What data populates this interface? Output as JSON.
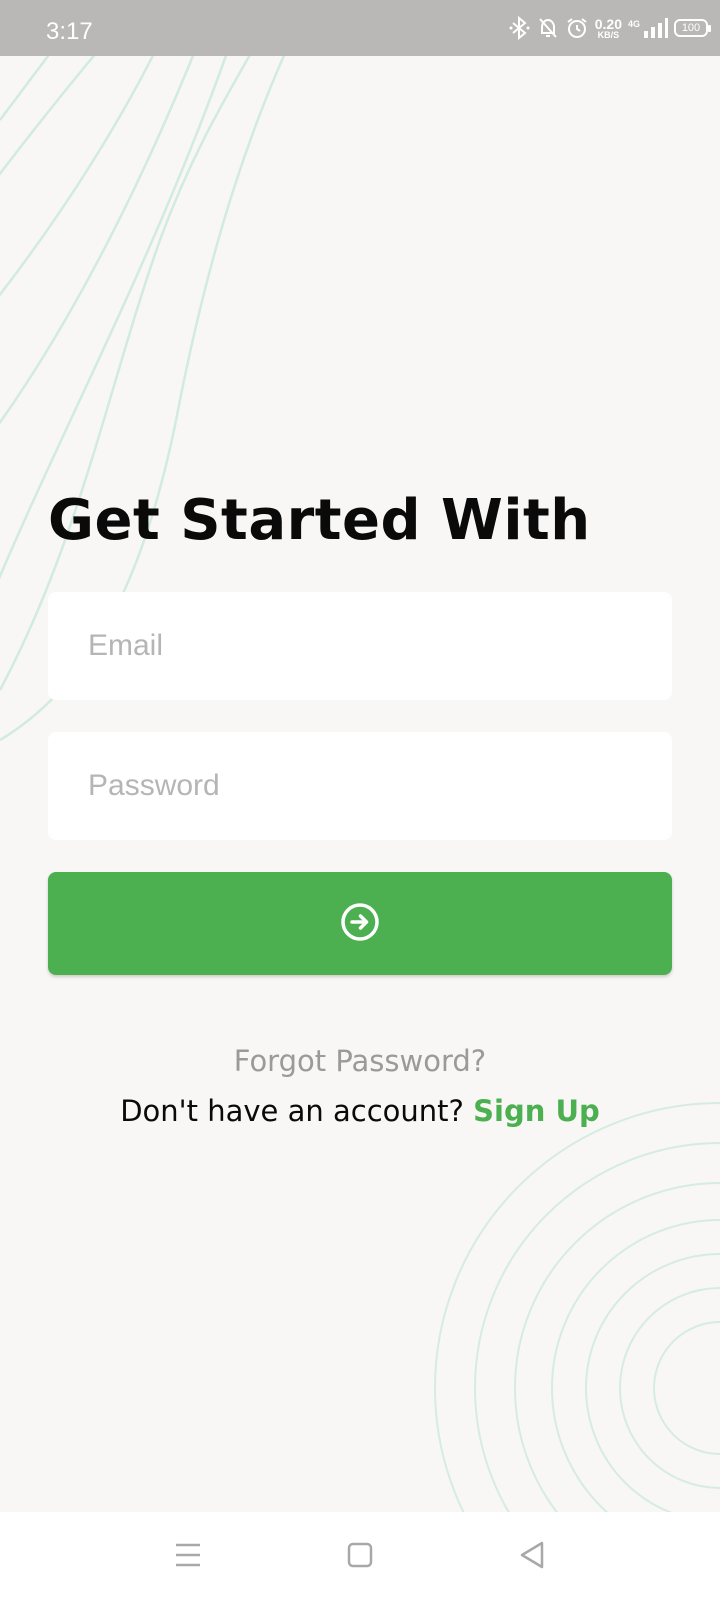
{
  "status_bar": {
    "time": "3:17",
    "net_speed_value": "0.20",
    "net_speed_unit": "KB/S",
    "network_type": "4G",
    "battery": "100",
    "icons": [
      "bluetooth-icon",
      "mute-notification-icon",
      "alarm-icon",
      "signal-icon",
      "battery-icon"
    ]
  },
  "login": {
    "title": "Get Started With",
    "email_placeholder": "Email",
    "password_placeholder": "Password",
    "submit_icon": "arrow-right-circle-icon",
    "forgot_password": "Forgot Password?",
    "no_account_text": "Don't have an account?",
    "sign_up": "Sign Up"
  },
  "nav_bar": {
    "icons": [
      "menu-icon",
      "home-icon",
      "back-icon"
    ]
  },
  "colors": {
    "accent": "#4caf50",
    "background": "#f8f7f5",
    "status_bar": "#b9b8b6",
    "decor_lines": "#cfe8dc"
  }
}
